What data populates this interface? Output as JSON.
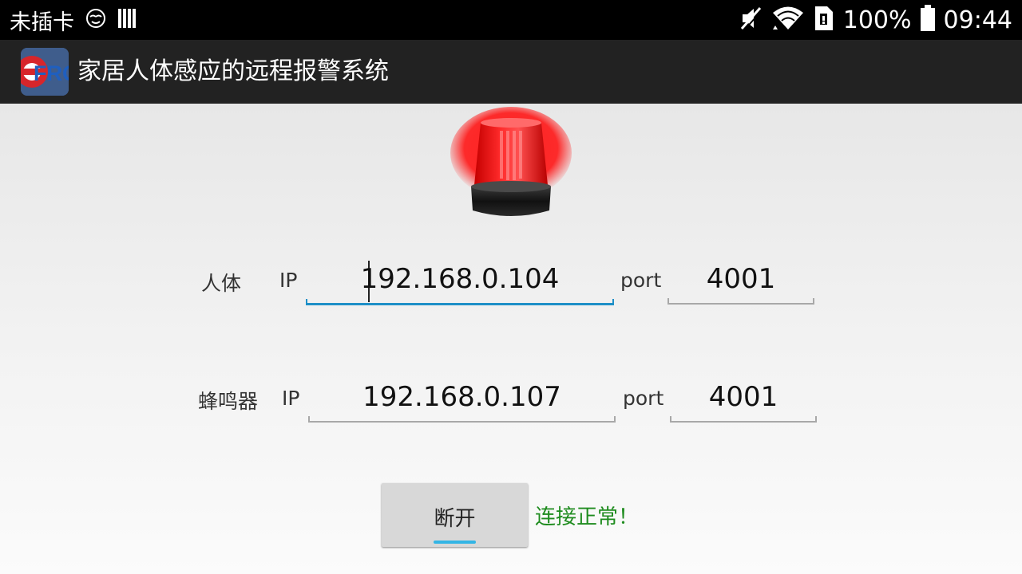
{
  "status_bar": {
    "carrier": "未插卡",
    "battery": "100%",
    "time": "09:44",
    "icons": [
      "emoji-face-icon",
      "signal-bars-icon",
      "mute-icon",
      "wifi-icon",
      "data-sync-icon",
      "battery-icon"
    ]
  },
  "action_bar": {
    "app_icon": "FRO",
    "title": "家居人体感应的远程报警系统"
  },
  "form": {
    "human": {
      "label": "人体",
      "ip_label": "IP",
      "ip": "192.168.0.104",
      "port_label": "port",
      "port": "4001"
    },
    "buzzer": {
      "label": "蜂鸣器",
      "ip_label": "IP",
      "ip": "192.168.0.107",
      "port_label": "port",
      "port": "4001"
    }
  },
  "actions": {
    "disconnect_label": "断开",
    "status_text": "连接正常！",
    "status_color": "#1f8c1f"
  },
  "colors": {
    "focus_accent": "#1e8fc7",
    "button_focus": "#33b5e5"
  }
}
